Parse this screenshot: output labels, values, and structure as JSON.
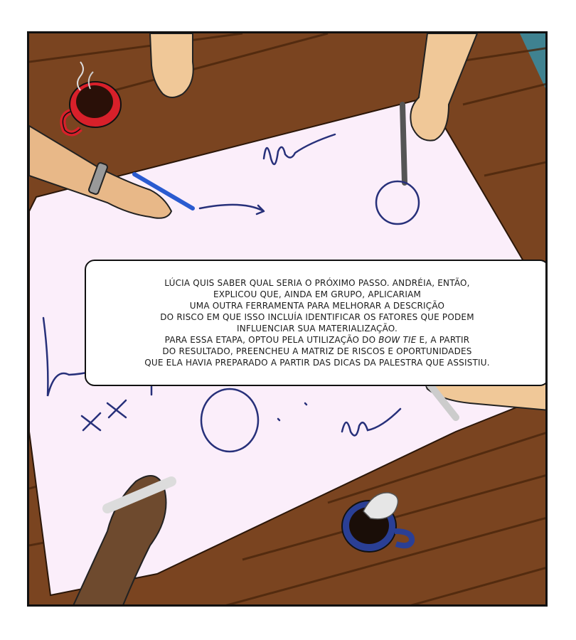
{
  "caption": {
    "lines": [
      "LÚCIA QUIS SABER QUAL SERIA O PRÓXIMO PASSO. ANDRÉIA, ENTÃO,",
      "EXPLICOU QUE, AINDA EM GRUPO, APLICARIAM",
      "UMA OUTRA FERRAMENTA PARA MELHORAR A DESCRIÇÃO",
      "DO RISCO EM QUE ISSO INCLUÍA IDENTIFICAR OS FATORES QUE PODEM",
      "INFLUENCIAR SUA MATERIALIZAÇÃO."
    ],
    "line6_before": "PARA ESSA ETAPA, OPTOU PELA UTILIZAÇÃO DO ",
    "line6_italic": "BOW TIE",
    "line6_after": " E, A PARTIR",
    "line7": "DO RESULTADO, PREENCHEU A MATRIZ DE RISCOS E OPORTUNIDADES",
    "line8": "QUE ELA HAVIA PREPARADO A PARTIR DAS DICAS DA PALESTRA QUE ASSISTIU."
  },
  "colors": {
    "table_wood": "#7a4420",
    "table_wood_dark": "#5a2f12",
    "paper": "#fbeefa",
    "ink": "#27307a",
    "floor": "#3f8290",
    "red_mug": "#d8202a",
    "blue_mug": "#2a3f95"
  }
}
